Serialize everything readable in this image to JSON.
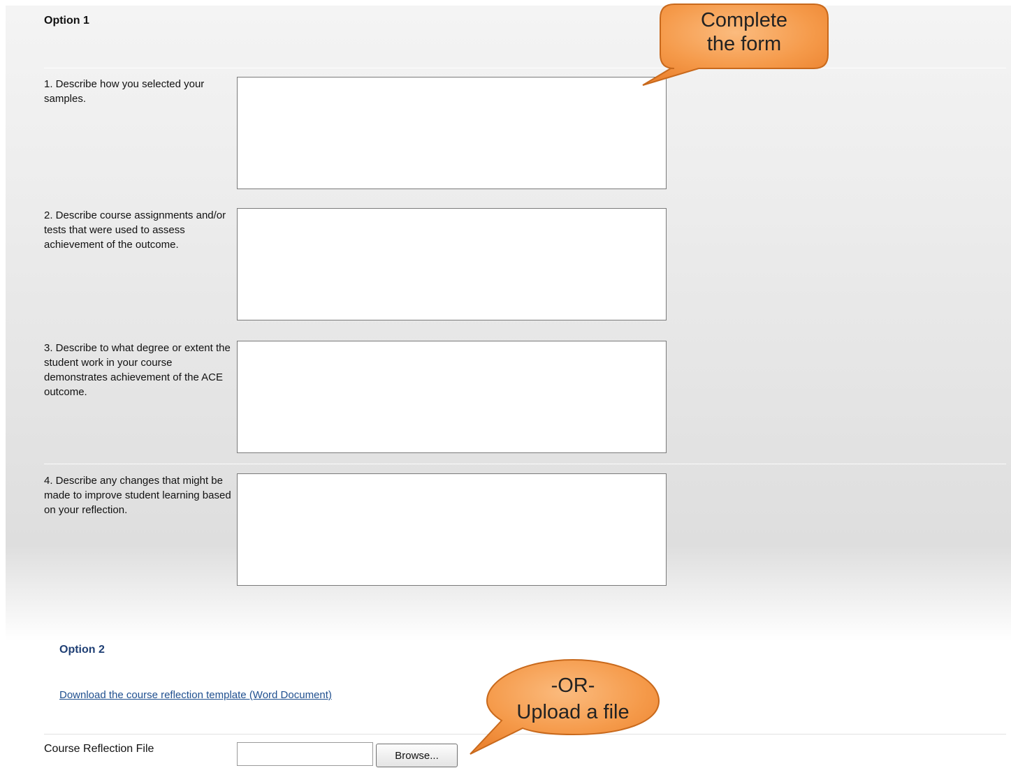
{
  "option1": {
    "title": "Option 1",
    "questions": [
      {
        "label": "1. Describe how you selected your samples.",
        "value": ""
      },
      {
        "label": "2. Describe course assignments and/or tests that were used to assess achievement of the outcome.",
        "value": ""
      },
      {
        "label": "3. Describe to what degree or extent the student work in your course demonstrates achievement of the ACE outcome.",
        "value": ""
      },
      {
        "label": "4. Describe any changes that might be made to improve student learning based on your reflection.",
        "value": ""
      }
    ]
  },
  "option2": {
    "title": "Option 2",
    "download_link": "Download the course reflection template (Word Document)"
  },
  "file_upload": {
    "label": "Course Reflection File",
    "value": "",
    "browse_label": "Browse..."
  },
  "callouts": {
    "complete": {
      "line1": "Complete",
      "line2": "the form"
    },
    "upload": {
      "line1": "-OR-",
      "line2": "Upload a file"
    }
  },
  "colors": {
    "callout_fill": "#f59a4a",
    "callout_stroke": "#c8691c",
    "link": "#1f4f8f",
    "option2_heading": "#1f3f74"
  }
}
